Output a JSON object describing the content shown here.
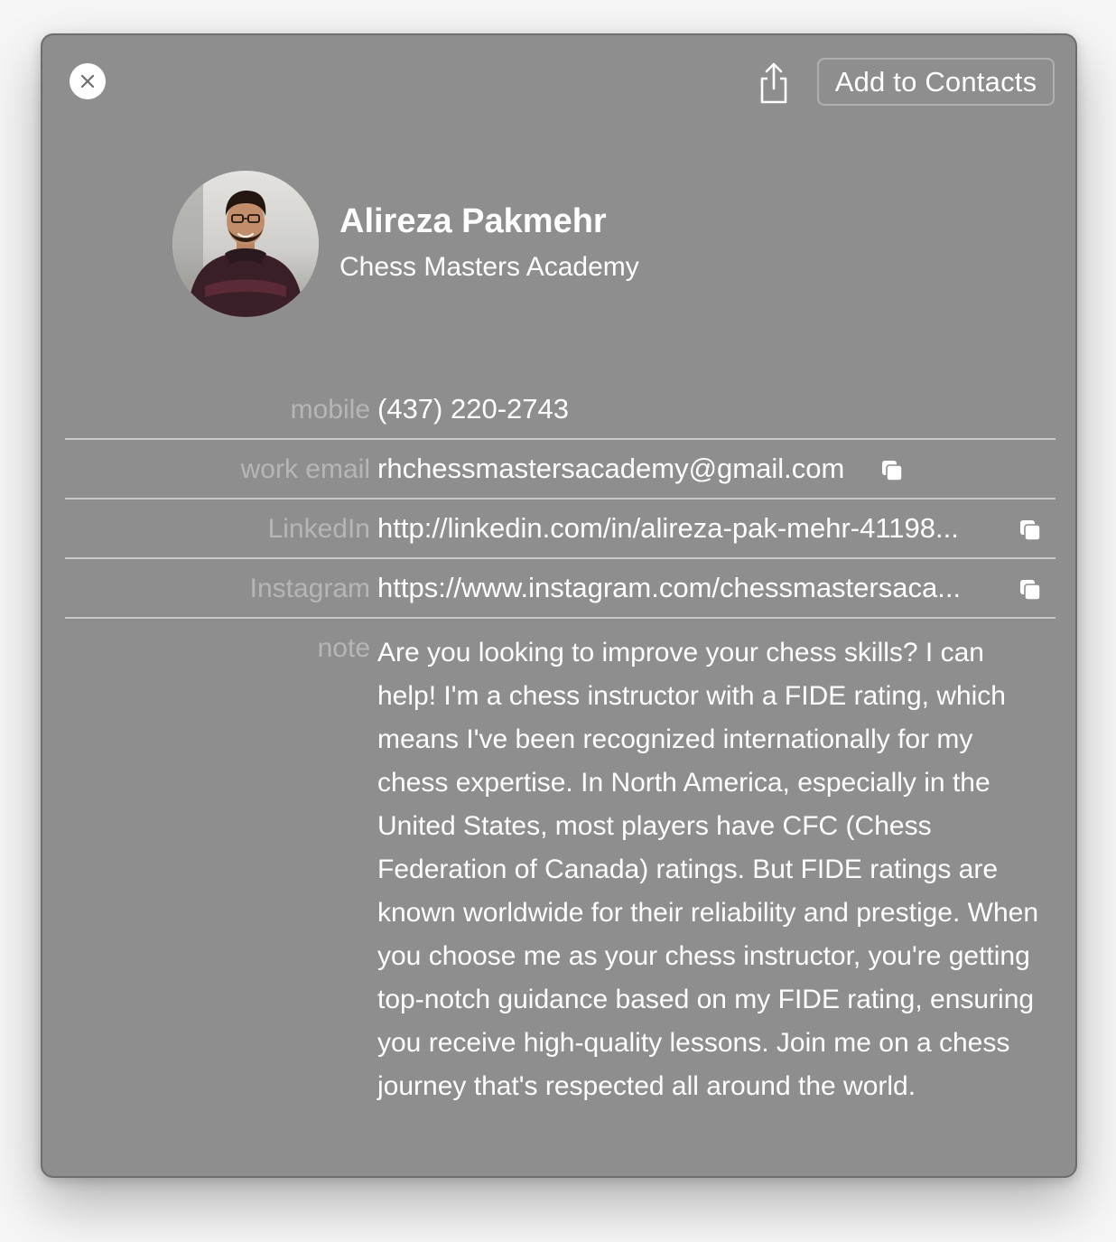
{
  "header": {
    "add_to_contacts_label": "Add to Contacts"
  },
  "contact": {
    "name": "Alireza Pakmehr",
    "company": "Chess Masters Academy"
  },
  "fields": {
    "mobile": {
      "label": "mobile",
      "value": "(437) 220-2743"
    },
    "work_email": {
      "label": "work email",
      "value": "rhchessmastersacademy@gmail.com"
    },
    "linkedin": {
      "label": "LinkedIn",
      "value": "http://linkedin.com/in/alireza-pak-mehr-41198..."
    },
    "instagram": {
      "label": "Instagram",
      "value": "https://www.instagram.com/chessmastersaca..."
    },
    "note": {
      "label": "note",
      "value": "Are you looking to improve your chess skills? I can help! I'm a chess instructor with a FIDE rating, which means I've been recognized internationally for my chess expertise. In North America, especially in the United States, most players have CFC (Chess Federation of Canada) ratings. But FIDE ratings are known worldwide for their reliability and prestige. When you choose me as your chess instructor, you're getting top-notch guidance based on my FIDE rating, ensuring you receive high-quality lessons. Join me on a chess journey that's respected all around the world."
    }
  },
  "icons": {
    "close": "close-icon",
    "share": "share-icon",
    "copy": "copy-icon"
  },
  "colors": {
    "card_background": "#8f8e8f",
    "label_text": "#b7b6b7",
    "value_text": "#ffffff",
    "divider": "#c8c7c8"
  }
}
